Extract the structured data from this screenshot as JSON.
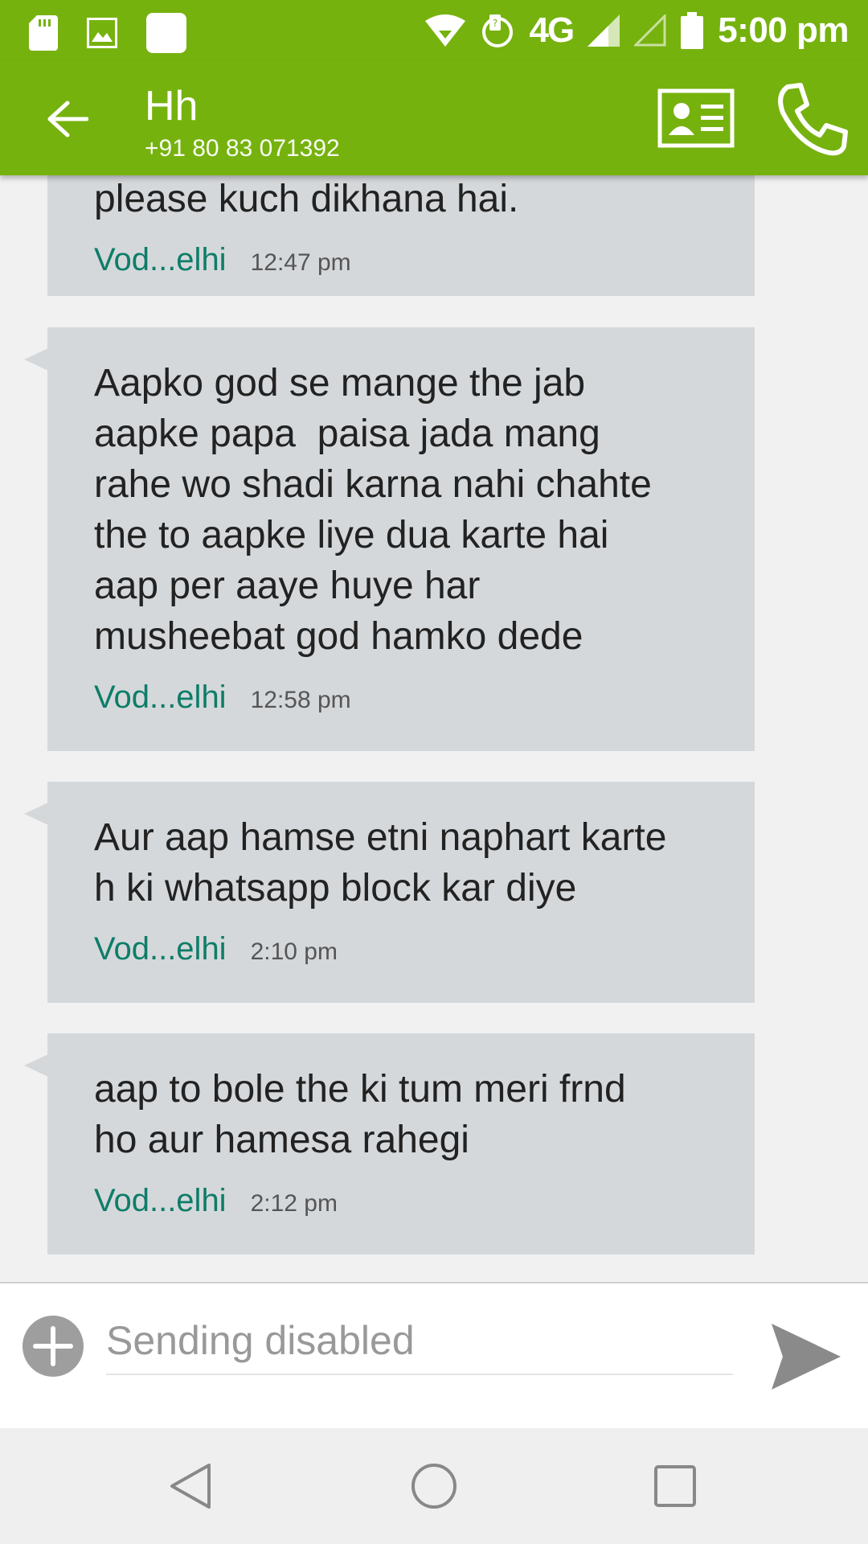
{
  "status_bar": {
    "network": "4G",
    "time": "5:00 pm",
    "left_icons": [
      "sd-card-icon",
      "image-icon",
      "app-square-icon"
    ],
    "right_icons": [
      "wifi-icon",
      "roaming-icon",
      "signal-icon",
      "signal-empty-icon",
      "battery-icon"
    ]
  },
  "header": {
    "contact_name": "Hh",
    "contact_number": "+91 80 83 071392",
    "actions": [
      "contact-card-icon",
      "phone-icon"
    ]
  },
  "messages": [
    {
      "text": "please kuch dikhana hai.",
      "sim": "Vod...elhi",
      "time": "12:47 pm"
    },
    {
      "text": "Aapko god se mange the jab\naapke papa  paisa jada mang\nrahe wo shadi karna nahi chahte\nthe to aapke liye dua karte hai\naap per aaye huye har\nmusheebat god hamko dede",
      "sim": "Vod...elhi",
      "time": "12:58 pm"
    },
    {
      "text": "Aur aap hamse etni naphart karte\nh ki whatsapp block kar diye",
      "sim": "Vod...elhi",
      "time": "2:10 pm"
    },
    {
      "text": "aap to bole the ki tum meri frnd\nho aur hamesa rahegi",
      "sim": "Vod...elhi",
      "time": "2:12 pm"
    }
  ],
  "composer": {
    "placeholder": "Sending disabled"
  },
  "colors": {
    "accent": "#76b20e",
    "bubble": "#d5d8db",
    "sim_label": "#0d7d68"
  }
}
